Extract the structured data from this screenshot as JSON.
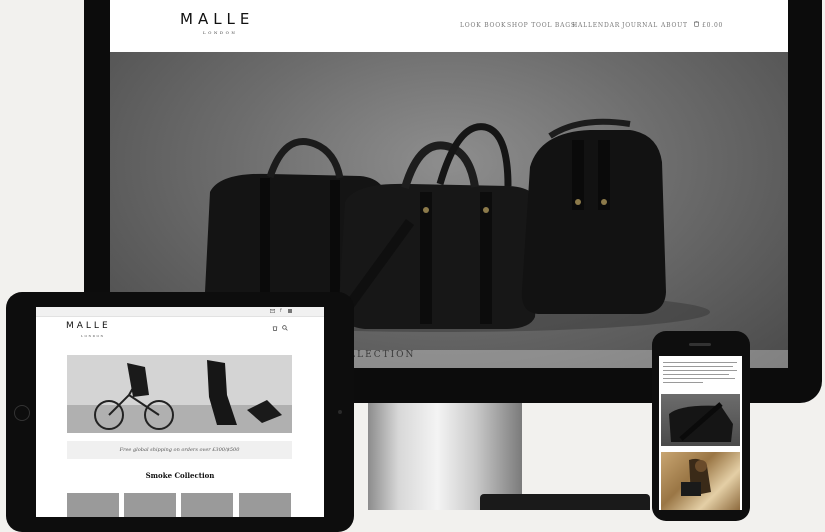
{
  "desktop": {
    "logo": "MALLE",
    "logo_sub": "LONDON",
    "nav": [
      {
        "label": "LOOK BOOK"
      },
      {
        "label": "SHOP TOOL BAGS"
      },
      {
        "label": "HALLENDAR"
      },
      {
        "label": "JOURNAL"
      },
      {
        "label": "ABOUT"
      }
    ],
    "cart_total": "£0.00",
    "hero_caption": "SMOKE COLLECTION"
  },
  "tablet": {
    "logo": "MALLE",
    "logo_sub": "LONDON",
    "shipping_banner": "Free global shipping on orders over £300/$500",
    "section_heading": "Smoke Collection"
  },
  "colors": {
    "device_black": "#0c0c0c",
    "hero_grey": "#6d6d6d",
    "page_bg": "#f2f1ee"
  },
  "icons": [
    "cart-icon",
    "envelope-icon",
    "facebook-icon",
    "twitter-icon",
    "search-icon"
  ]
}
